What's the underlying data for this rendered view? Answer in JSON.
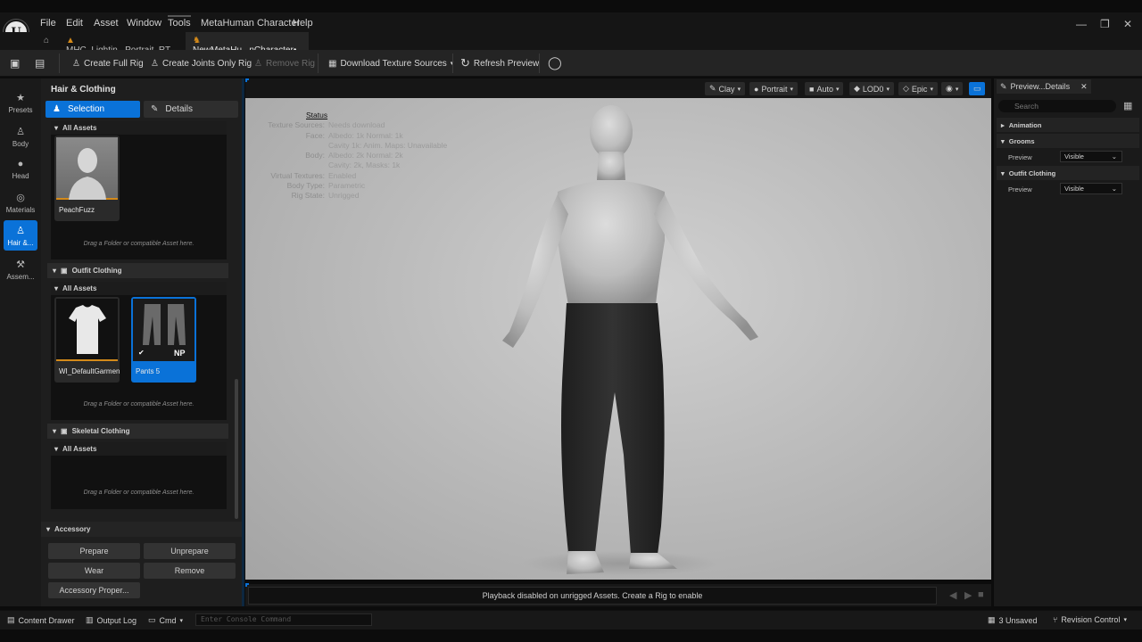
{
  "menu": {
    "items": [
      "File",
      "Edit",
      "Asset",
      "Window",
      "Tools",
      "MetaHuman Character",
      "Help"
    ]
  },
  "tabs": [
    {
      "label": "MHC_Lightin...Portrait_RT"
    },
    {
      "label": "NewMetaHu...nCharacter•",
      "close": "×"
    }
  ],
  "toolbar": {
    "create_full_rig": "Create Full Rig",
    "create_joints_only_rig": "Create Joints Only Rig",
    "remove_rig": "Remove Rig",
    "download_texture_sources": "Download Texture Sources",
    "refresh_preview": "Refresh Preview"
  },
  "left_rail": {
    "items": [
      {
        "label": "Presets",
        "icon": "star-icon"
      },
      {
        "label": "Body",
        "icon": "body-icon"
      },
      {
        "label": "Head",
        "icon": "head-icon"
      },
      {
        "label": "Materials",
        "icon": "materials-icon"
      },
      {
        "label": "Hair &...",
        "icon": "hair-icon",
        "active": true
      },
      {
        "label": "Assem...",
        "icon": "hammer-icon"
      }
    ]
  },
  "panel": {
    "title": "Hair & Clothing",
    "selection_tab": "Selection",
    "details_tab": "Details",
    "all_assets": "All Assets",
    "drag_hint": "Drag a Folder or compatible Asset here.",
    "groom_asset": "PeachFuzz",
    "outfit_section": "Outfit Clothing",
    "outfit_assets": [
      "WI_DefaultGarment",
      "Pants 5"
    ],
    "np_badge": "NP",
    "skeletal_section": "Skeletal Clothing",
    "accessory_section": "Accessory",
    "accessory_buttons": {
      "prepare": "Prepare",
      "unprepare": "Unprepare",
      "wear": "Wear",
      "remove": "Remove",
      "properties": "Accessory Proper..."
    }
  },
  "viewport": {
    "buttons": {
      "clay": "Clay",
      "portrait": "Portrait",
      "auto": "Auto",
      "lod": "LOD0",
      "epic": "Epic"
    },
    "status": {
      "title": "Status",
      "rows": [
        {
          "k": "Texture Sources:",
          "v": "Needs download"
        },
        {
          "k": "Face:",
          "v": "Albedo: 1k Normal: 1k"
        },
        {
          "k": "",
          "v": "Cavity 1k: Anim. Maps: Unavailable"
        },
        {
          "k": "Body:",
          "v": "Albedo: 2k Normal: 2k"
        },
        {
          "k": "",
          "v": "Cavity: 2k, Masks: 1k"
        },
        {
          "k": "Virtual Textures:",
          "v": "Enabled"
        },
        {
          "k": "Body Type:",
          "v": "Parametric"
        },
        {
          "k": "Rig State:",
          "v": "Unrigged"
        }
      ]
    },
    "playback_message": "Playback disabled on unrigged Assets. Create a Rig to enable"
  },
  "details": {
    "tab": "Preview...Details",
    "search_placeholder": "Search",
    "categories": {
      "animation": "Animation",
      "grooms": "Grooms",
      "outfit": "Outfit Clothing"
    },
    "prop_preview": "Preview",
    "visible": "Visible"
  },
  "statusbar": {
    "content_drawer": "Content Drawer",
    "output_log": "Output Log",
    "cmd": "Cmd",
    "console_placeholder": "Enter Console Command",
    "unsaved": "3 Unsaved",
    "revision_control": "Revision Control"
  }
}
